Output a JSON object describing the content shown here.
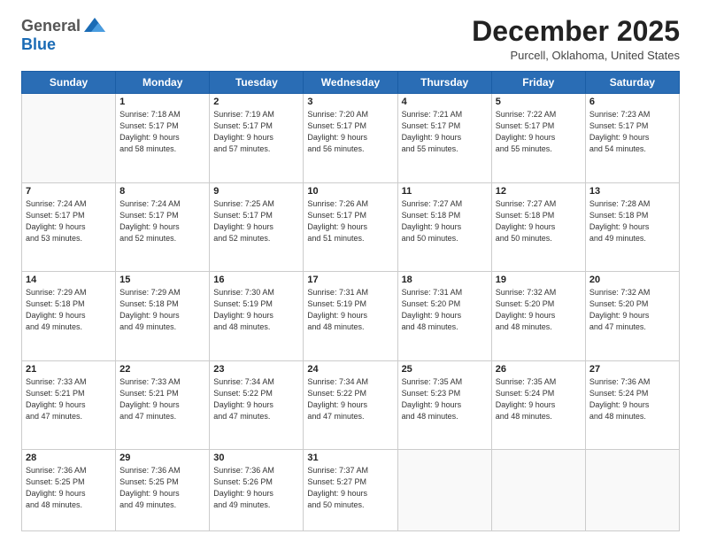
{
  "header": {
    "logo_general": "General",
    "logo_blue": "Blue",
    "month": "December 2025",
    "location": "Purcell, Oklahoma, United States"
  },
  "weekdays": [
    "Sunday",
    "Monday",
    "Tuesday",
    "Wednesday",
    "Thursday",
    "Friday",
    "Saturday"
  ],
  "weeks": [
    [
      {
        "day": "",
        "info": ""
      },
      {
        "day": "1",
        "info": "Sunrise: 7:18 AM\nSunset: 5:17 PM\nDaylight: 9 hours\nand 58 minutes."
      },
      {
        "day": "2",
        "info": "Sunrise: 7:19 AM\nSunset: 5:17 PM\nDaylight: 9 hours\nand 57 minutes."
      },
      {
        "day": "3",
        "info": "Sunrise: 7:20 AM\nSunset: 5:17 PM\nDaylight: 9 hours\nand 56 minutes."
      },
      {
        "day": "4",
        "info": "Sunrise: 7:21 AM\nSunset: 5:17 PM\nDaylight: 9 hours\nand 55 minutes."
      },
      {
        "day": "5",
        "info": "Sunrise: 7:22 AM\nSunset: 5:17 PM\nDaylight: 9 hours\nand 55 minutes."
      },
      {
        "day": "6",
        "info": "Sunrise: 7:23 AM\nSunset: 5:17 PM\nDaylight: 9 hours\nand 54 minutes."
      }
    ],
    [
      {
        "day": "7",
        "info": "Sunrise: 7:24 AM\nSunset: 5:17 PM\nDaylight: 9 hours\nand 53 minutes."
      },
      {
        "day": "8",
        "info": "Sunrise: 7:24 AM\nSunset: 5:17 PM\nDaylight: 9 hours\nand 52 minutes."
      },
      {
        "day": "9",
        "info": "Sunrise: 7:25 AM\nSunset: 5:17 PM\nDaylight: 9 hours\nand 52 minutes."
      },
      {
        "day": "10",
        "info": "Sunrise: 7:26 AM\nSunset: 5:17 PM\nDaylight: 9 hours\nand 51 minutes."
      },
      {
        "day": "11",
        "info": "Sunrise: 7:27 AM\nSunset: 5:18 PM\nDaylight: 9 hours\nand 50 minutes."
      },
      {
        "day": "12",
        "info": "Sunrise: 7:27 AM\nSunset: 5:18 PM\nDaylight: 9 hours\nand 50 minutes."
      },
      {
        "day": "13",
        "info": "Sunrise: 7:28 AM\nSunset: 5:18 PM\nDaylight: 9 hours\nand 49 minutes."
      }
    ],
    [
      {
        "day": "14",
        "info": "Sunrise: 7:29 AM\nSunset: 5:18 PM\nDaylight: 9 hours\nand 49 minutes."
      },
      {
        "day": "15",
        "info": "Sunrise: 7:29 AM\nSunset: 5:18 PM\nDaylight: 9 hours\nand 49 minutes."
      },
      {
        "day": "16",
        "info": "Sunrise: 7:30 AM\nSunset: 5:19 PM\nDaylight: 9 hours\nand 48 minutes."
      },
      {
        "day": "17",
        "info": "Sunrise: 7:31 AM\nSunset: 5:19 PM\nDaylight: 9 hours\nand 48 minutes."
      },
      {
        "day": "18",
        "info": "Sunrise: 7:31 AM\nSunset: 5:20 PM\nDaylight: 9 hours\nand 48 minutes."
      },
      {
        "day": "19",
        "info": "Sunrise: 7:32 AM\nSunset: 5:20 PM\nDaylight: 9 hours\nand 48 minutes."
      },
      {
        "day": "20",
        "info": "Sunrise: 7:32 AM\nSunset: 5:20 PM\nDaylight: 9 hours\nand 47 minutes."
      }
    ],
    [
      {
        "day": "21",
        "info": "Sunrise: 7:33 AM\nSunset: 5:21 PM\nDaylight: 9 hours\nand 47 minutes."
      },
      {
        "day": "22",
        "info": "Sunrise: 7:33 AM\nSunset: 5:21 PM\nDaylight: 9 hours\nand 47 minutes."
      },
      {
        "day": "23",
        "info": "Sunrise: 7:34 AM\nSunset: 5:22 PM\nDaylight: 9 hours\nand 47 minutes."
      },
      {
        "day": "24",
        "info": "Sunrise: 7:34 AM\nSunset: 5:22 PM\nDaylight: 9 hours\nand 47 minutes."
      },
      {
        "day": "25",
        "info": "Sunrise: 7:35 AM\nSunset: 5:23 PM\nDaylight: 9 hours\nand 48 minutes."
      },
      {
        "day": "26",
        "info": "Sunrise: 7:35 AM\nSunset: 5:24 PM\nDaylight: 9 hours\nand 48 minutes."
      },
      {
        "day": "27",
        "info": "Sunrise: 7:36 AM\nSunset: 5:24 PM\nDaylight: 9 hours\nand 48 minutes."
      }
    ],
    [
      {
        "day": "28",
        "info": "Sunrise: 7:36 AM\nSunset: 5:25 PM\nDaylight: 9 hours\nand 48 minutes."
      },
      {
        "day": "29",
        "info": "Sunrise: 7:36 AM\nSunset: 5:25 PM\nDaylight: 9 hours\nand 49 minutes."
      },
      {
        "day": "30",
        "info": "Sunrise: 7:36 AM\nSunset: 5:26 PM\nDaylight: 9 hours\nand 49 minutes."
      },
      {
        "day": "31",
        "info": "Sunrise: 7:37 AM\nSunset: 5:27 PM\nDaylight: 9 hours\nand 50 minutes."
      },
      {
        "day": "",
        "info": ""
      },
      {
        "day": "",
        "info": ""
      },
      {
        "day": "",
        "info": ""
      }
    ]
  ]
}
